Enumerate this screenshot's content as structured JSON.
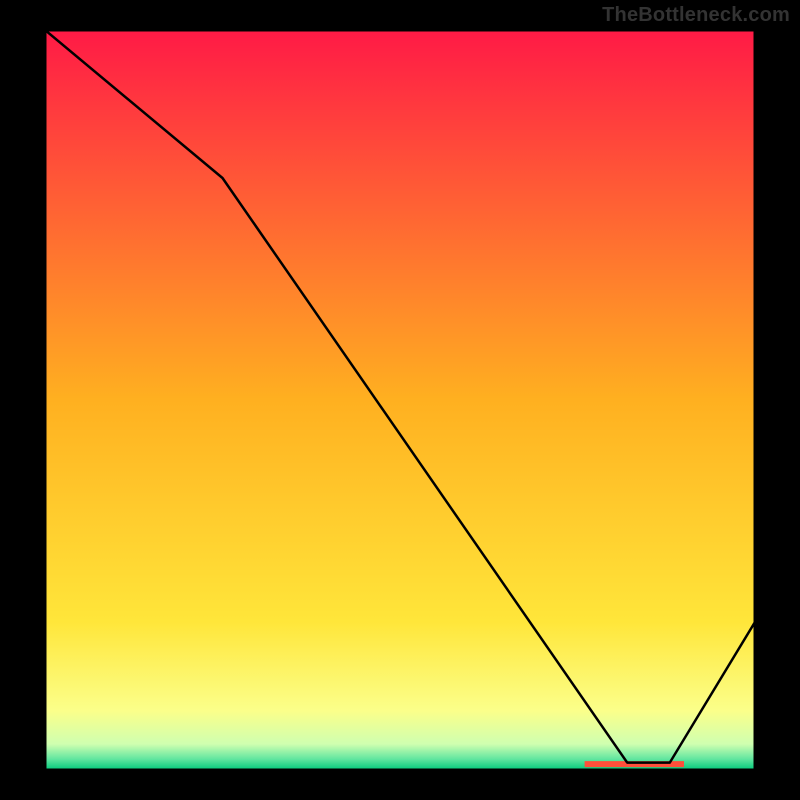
{
  "watermark": "TheBottleneck.com",
  "chart_data": {
    "type": "line",
    "title": "",
    "xlabel": "",
    "ylabel": "",
    "xlim": [
      0,
      100
    ],
    "ylim": [
      0,
      100
    ],
    "categories": [
      0,
      25,
      82,
      88,
      100
    ],
    "values": [
      100,
      80,
      1,
      1,
      20
    ],
    "highlight_band_x": [
      76,
      90
    ],
    "highlight_band_color": "#ff4f3a",
    "gradient_stops": [
      {
        "offset": 0.0,
        "color": "#ff1a46"
      },
      {
        "offset": 0.5,
        "color": "#ffb020"
      },
      {
        "offset": 0.8,
        "color": "#ffe63a"
      },
      {
        "offset": 0.92,
        "color": "#fbff8a"
      },
      {
        "offset": 0.965,
        "color": "#cfffb0"
      },
      {
        "offset": 0.985,
        "color": "#62e6a0"
      },
      {
        "offset": 1.0,
        "color": "#00c97a"
      }
    ]
  }
}
